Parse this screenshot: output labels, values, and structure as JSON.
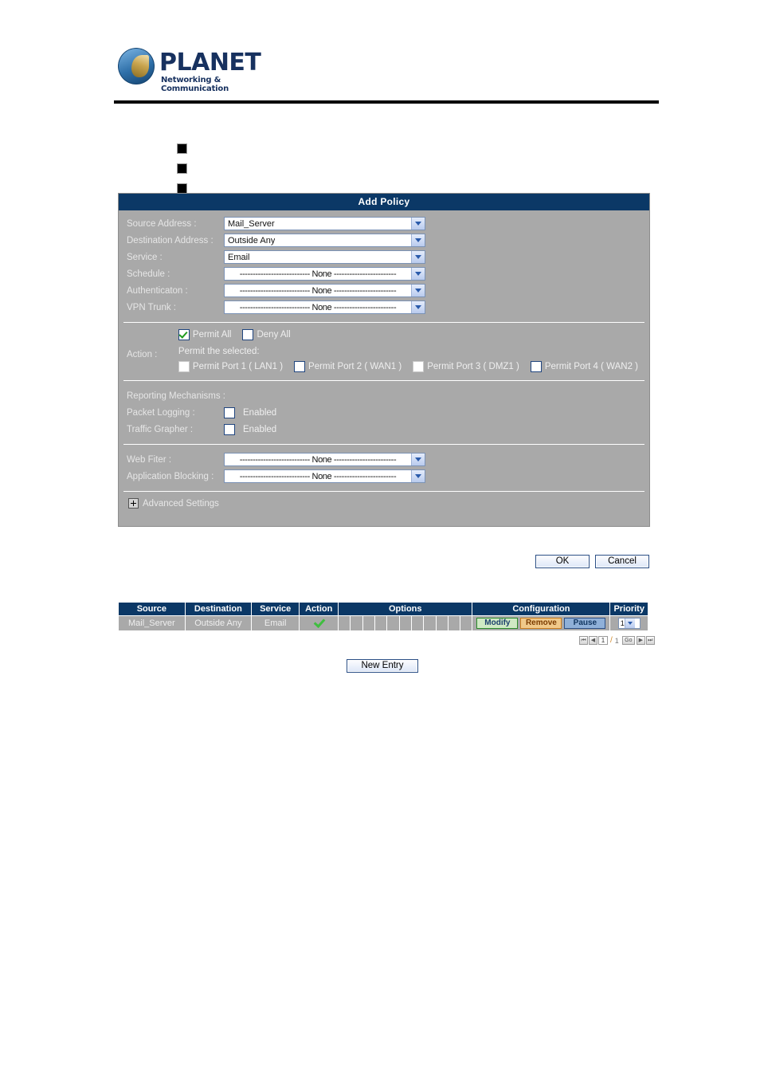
{
  "brand": {
    "name": "PLANET",
    "tagline": "Networking & Communication"
  },
  "bullets": [
    "",
    "",
    ""
  ],
  "dialog": {
    "title": "Add Policy",
    "fields": [
      {
        "label": "Source Address :",
        "value": "Mail_Server",
        "centered": false
      },
      {
        "label": "Destination Address :",
        "value": "Outside Any",
        "centered": false
      },
      {
        "label": "Service :",
        "value": "Email",
        "centered": false
      },
      {
        "label": "Schedule :",
        "value": "--------------------------- None ------------------------",
        "centered": true
      },
      {
        "label": "Authenticaton :",
        "value": "--------------------------- None ------------------------",
        "centered": true
      },
      {
        "label": "VPN Trunk :",
        "value": "--------------------------- None ------------------------",
        "centered": true
      }
    ],
    "action": {
      "label": "Action :",
      "permit_all_label": "Permit All",
      "permit_all_checked": true,
      "deny_all_label": "Deny All",
      "deny_all_checked": false,
      "permit_selected_label": "Permit the selected:",
      "ports": [
        {
          "label": "Permit Port  1  ( LAN1 )",
          "checked": false
        },
        {
          "label": "Permit Port  2  ( WAN1 )",
          "checked": false
        },
        {
          "label": "Permit Port  3  ( DMZ1 )",
          "checked": false
        },
        {
          "label": "Permit Port  4  ( WAN2 )",
          "checked": false
        }
      ]
    },
    "reporting": {
      "heading": "Reporting Mechanisms :",
      "packet_logging_label": "Packet Logging :",
      "packet_logging_value": "Enabled",
      "packet_logging_checked": false,
      "traffic_grapher_label": "Traffic Grapher :",
      "traffic_grapher_value": "Enabled",
      "traffic_grapher_checked": false
    },
    "filters": [
      {
        "label": "Web Fiter :",
        "value": "--------------------------- None ------------------------"
      },
      {
        "label": "Application Blocking :",
        "value": "--------------------------- None ------------------------"
      }
    ],
    "advanced_settings_label": "Advanced Settings",
    "ok_label": "OK",
    "cancel_label": "Cancel"
  },
  "table": {
    "headers": [
      "Source",
      "Destination",
      "Service",
      "Action",
      "Options",
      "Configuration",
      "Priority"
    ],
    "options_cell_count": 11,
    "rows": [
      {
        "source": "Mail_Server",
        "destination": "Outside Any",
        "service": "Email",
        "action_icon": "green-check-icon",
        "configuration": {
          "modify_label": "Modify",
          "remove_label": "Remove",
          "pause_label": "Pause"
        },
        "priority": "1"
      }
    ]
  },
  "pagination": {
    "first_icon": "⏮",
    "prev_icon": "◀",
    "current_page": "1",
    "separator": "/",
    "total_pages": "1",
    "go_label": "Go",
    "next_icon": "▶",
    "last_icon": "⏭"
  },
  "new_entry_label": "New Entry",
  "colors": {
    "header_navy": "#0b3866",
    "panel_gray": "#a9a9a9",
    "brand_navy": "#17315f",
    "modify_green": "#cfe9c4",
    "remove_orange": "#f0c98a",
    "pause_blue": "#8fb0d8"
  }
}
